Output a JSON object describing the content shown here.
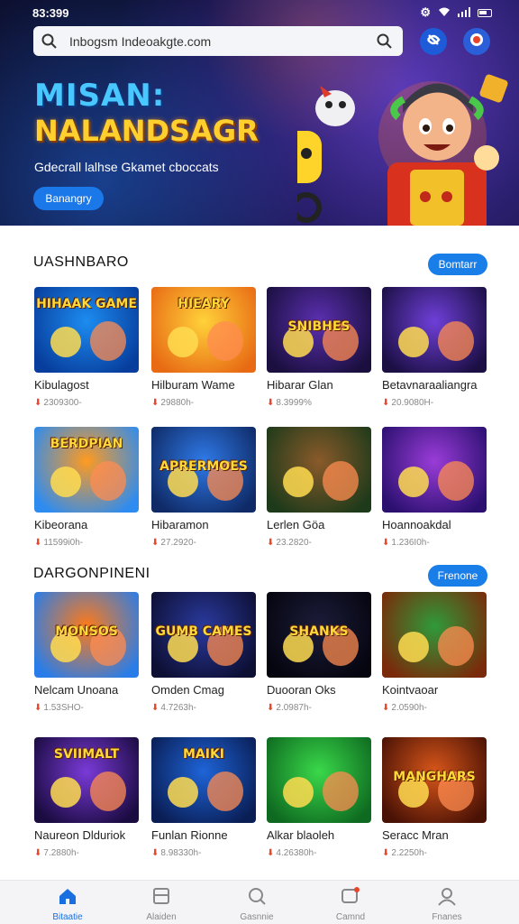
{
  "status_bar": {
    "time": "83:399"
  },
  "search": {
    "text": "Inbogsm Indeoakgte.com"
  },
  "hero": {
    "title_line1": "MISAN:",
    "title_line2": "NALANDSAGR",
    "subtitle": "Gdecrall lalhse Gkamet cboccats",
    "button": "Banangry"
  },
  "sections": [
    {
      "title": "UASHNBARO",
      "action": "Bomtarr",
      "games": [
        {
          "name": "Kibulagost",
          "meta": "2309300-",
          "art": "HIHAAK GAME",
          "c1": "#1d8cf0",
          "c2": "#073d9c"
        },
        {
          "name": "Hilburam Wame",
          "meta": "29880h-",
          "art": "HIEARY",
          "c1": "#ffd23a",
          "c2": "#e86b14"
        },
        {
          "name": "Hibarar Glan",
          "meta": "8.3999%",
          "art": "SNIBHES",
          "c1": "#5b2fb0",
          "c2": "#1a0f3e"
        },
        {
          "name": "Betavnaraaliangra",
          "meta": "20.9080H-",
          "art": "",
          "c1": "#6f3fd8",
          "c2": "#1b0f44"
        }
      ]
    },
    {
      "title": "",
      "action": "",
      "games": [
        {
          "name": "Kibeorana",
          "meta": "11599i0h-",
          "art": "BERDPIAN",
          "c1": "#ff9a1f",
          "c2": "#2e8cf0"
        },
        {
          "name": "Hibaramon",
          "meta": "27.2920-",
          "art": "APRERMOES",
          "c1": "#2f7ae8",
          "c2": "#0f2a66"
        },
        {
          "name": "Lerlen Göa",
          "meta": "23.2820-",
          "art": "",
          "c1": "#8a5a2a",
          "c2": "#1d3a1a"
        },
        {
          "name": "Hoannoakdal",
          "meta": "1.236I0h-",
          "art": "",
          "c1": "#9a3cd8",
          "c2": "#2b1070"
        }
      ]
    },
    {
      "title": "DARGONPINENI",
      "action": "Frenone",
      "games": [
        {
          "name": "Nelcam Unoana",
          "meta": "1.53SHO-",
          "art": "MONSOS",
          "c1": "#ff7a18",
          "c2": "#2a7de8"
        },
        {
          "name": "Omden Cmag",
          "meta": "4.7263h-",
          "art": "GUMB CAMES",
          "c1": "#2a3a9e",
          "c2": "#0d0f33"
        },
        {
          "name": "Duooran Oks",
          "meta": "2.0987h-",
          "art": "SHANKS",
          "c1": "#1c1c3a",
          "c2": "#05050f"
        },
        {
          "name": "Kointvaoar",
          "meta": "2.0590h-",
          "art": "",
          "c1": "#2f9a3a",
          "c2": "#7a2a0a"
        }
      ]
    },
    {
      "title": "",
      "action": "",
      "games": [
        {
          "name": "Naureon Dlduriok",
          "meta": "7.2880h-",
          "art": "SVIIMALT",
          "c1": "#7a3ad8",
          "c2": "#1a0b40"
        },
        {
          "name": "Funlan Rionne",
          "meta": "8.98330h-",
          "art": "MAIKI",
          "c1": "#1e64d8",
          "c2": "#0a1e55"
        },
        {
          "name": "Alkar blaoleh",
          "meta": "4.26380h-",
          "art": "",
          "c1": "#3ad84a",
          "c2": "#0e6a20"
        },
        {
          "name": "Seracc Mran",
          "meta": "2.2250h-",
          "art": "MANGHARS",
          "c1": "#d8561a",
          "c2": "#4a1205"
        }
      ]
    }
  ],
  "nav": [
    {
      "label": "Bitaatie",
      "icon": "home-icon",
      "active": true
    },
    {
      "label": "Alaiden",
      "icon": "library-icon",
      "active": false
    },
    {
      "label": "Gasnnie",
      "icon": "search-icon",
      "active": false
    },
    {
      "label": "Camnd",
      "icon": "messages-icon",
      "active": false
    },
    {
      "label": "Fnanes",
      "icon": "profile-icon",
      "active": false
    }
  ]
}
